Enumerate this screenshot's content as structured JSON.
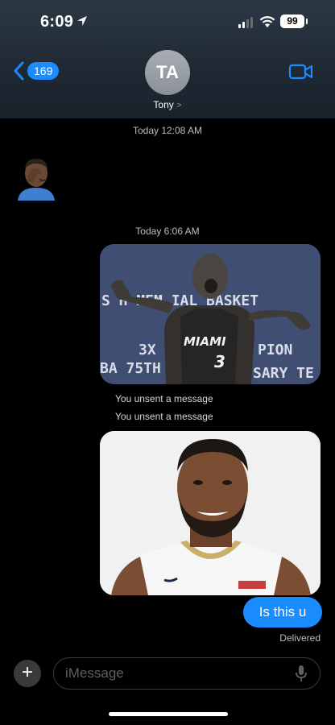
{
  "status_bar": {
    "time": "6:09",
    "battery": "99"
  },
  "header": {
    "back_count": "169",
    "avatar_initials": "TA",
    "contact_name": "Tony",
    "contact_chevron": ">"
  },
  "messages": {
    "timestamp_1": "Today 12:08 AM",
    "timestamp_2": "Today 6:06 AM",
    "unsent_1": "You unsent a message",
    "unsent_2": "You unsent a message",
    "text_message": "Is this u",
    "delivered": "Delivered"
  },
  "composer": {
    "placeholder": "iMessage",
    "plus_label": "+"
  },
  "images": {
    "photo_1_text": [
      "S  H MEM   IAL BASKET",
      "3X",
      "PION",
      "BA 75TH",
      "SARY TE",
      "MIAMI",
      "3"
    ]
  },
  "colors": {
    "accent": "#1a8cff",
    "bubble": "#1a8cff",
    "background": "#000000"
  }
}
